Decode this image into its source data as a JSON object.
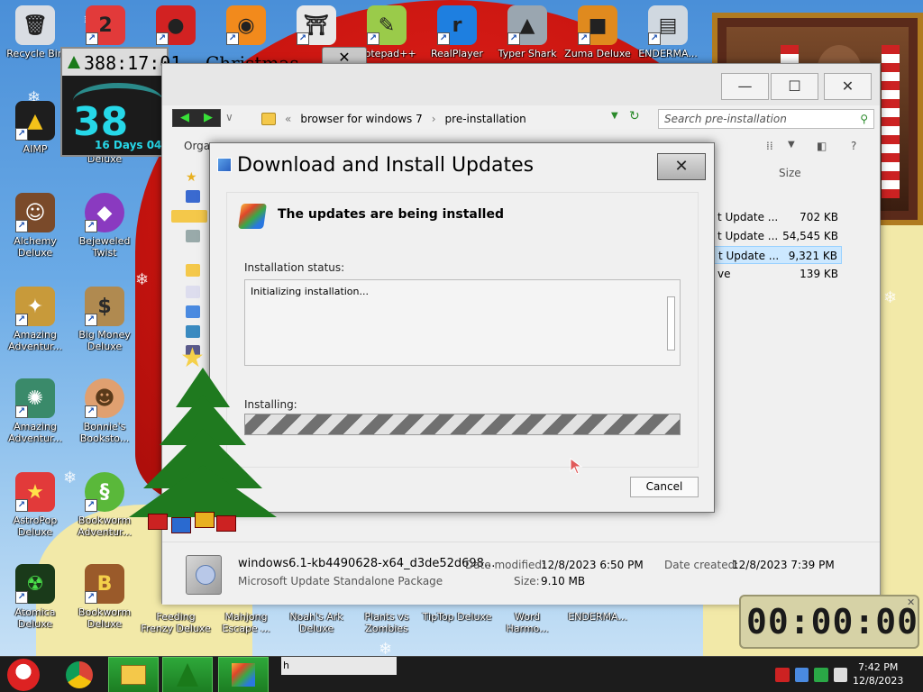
{
  "desktop": {
    "icons_top": [
      {
        "label": "Recycle Bin",
        "name": "recycle-bin",
        "color": "#d9dde3",
        "glyph": "🗑"
      },
      {
        "label": "",
        "name": "number-two-game",
        "color": "#e23a3a",
        "glyph": "2"
      },
      {
        "label": "",
        "name": "red-creature-game",
        "color": "#d22222",
        "glyph": "●"
      },
      {
        "label": "",
        "name": "firefox",
        "color": "#f28a1c",
        "glyph": "◉"
      },
      {
        "label": "",
        "name": "shrine-game",
        "color": "#e8e8e8",
        "glyph": "⛩"
      },
      {
        "label": "Notepad++",
        "name": "notepad-plus-plus",
        "color": "#9acb4a",
        "glyph": "✎"
      },
      {
        "label": "RealPlayer",
        "name": "realplayer",
        "color": "#1e7fe0",
        "glyph": "r"
      },
      {
        "label": "Typer Shark",
        "name": "typer-shark",
        "color": "#9aa6b0",
        "glyph": "▲"
      },
      {
        "label": "Zuma Deluxe",
        "name": "zuma-deluxe",
        "color": "#e08a1e",
        "glyph": "■"
      },
      {
        "label": "ENDERMA...",
        "name": "enderma-top",
        "color": "#d0d8e0",
        "glyph": "▤"
      }
    ],
    "icons_left": [
      {
        "label": "AIMP",
        "name": "aimp"
      },
      {
        "label": "Alchemy Deluxe",
        "name": "alchemy-deluxe"
      },
      {
        "label": "Bejeweled Twist",
        "name": "bejeweled-twist"
      },
      {
        "label": "Amazing Adventur...",
        "name": "amazing-adventures-1"
      },
      {
        "label": "Big Money Deluxe",
        "name": "big-money-deluxe"
      },
      {
        "label": "Amazing Adventur...",
        "name": "amazing-adventures-2"
      },
      {
        "label": "Bonnie's Booksto...",
        "name": "bonnies-bookstore"
      },
      {
        "label": "AstroPop Deluxe",
        "name": "astropop-deluxe"
      },
      {
        "label": "Bookworm Adventur...",
        "name": "bookworm-adventures"
      },
      {
        "label": "Atomica Deluxe",
        "name": "atomica-deluxe"
      },
      {
        "label": "Bookworm Deluxe",
        "name": "bookworm-deluxe"
      }
    ],
    "icons_bottom": [
      {
        "label": "Feeding Frenzy Deluxe",
        "name": "feeding-frenzy"
      },
      {
        "label": "Mahjong Escape ...",
        "name": "mahjong-escape"
      },
      {
        "label": "Noah's Ark Deluxe",
        "name": "noahs-ark"
      },
      {
        "label": "Plants vs Zombies",
        "name": "plants-vs-zombies"
      },
      {
        "label": "TipTop Deluxe",
        "name": "tiptop-deluxe"
      },
      {
        "label": "Word Harmo...",
        "name": "word-harmony"
      },
      {
        "label": "ENDERMA...",
        "name": "enderma-bottom"
      }
    ],
    "deluxe_label": "Deluxe"
  },
  "countdown": {
    "clock": "388:17:01",
    "title": "Christmas",
    "big": "38",
    "days": "16 Days 04"
  },
  "explorer": {
    "breadcrumb": [
      "browser for windows 7",
      "pre-installation"
    ],
    "search_placeholder": "Search pre-installation",
    "organize": "Orga",
    "size_header": "Size",
    "files": [
      {
        "name": "t Update ...",
        "size": "702 KB",
        "selected": false
      },
      {
        "name": "t Update ...",
        "size": "54,545 KB",
        "selected": false
      },
      {
        "name": "t Update ...",
        "size": "9,321 KB",
        "selected": true
      },
      {
        "name": "ve",
        "size": "139 KB",
        "selected": false
      }
    ],
    "details": {
      "filename": "windows6.1-kb4490628-x64_d3de52d698...",
      "type": "Microsoft Update Standalone Package",
      "modified_label": "Date modified:",
      "modified_value": "12/8/2023 6:50 PM",
      "created_label": "Date created:",
      "created_value": "12/8/2023 7:39 PM",
      "size_label": "Size:",
      "size_value": "9.10 MB"
    }
  },
  "dialog": {
    "title": "Download and Install Updates",
    "heading": "The updates are being installed",
    "status_label": "Installation status:",
    "status_text": "Initializing installation...",
    "installing_label": "Installing:",
    "cancel": "Cancel"
  },
  "timer": {
    "value": "00:00:00"
  },
  "taskbar": {
    "input_text": "h",
    "time": "7:42 PM",
    "date": "12/8/2023"
  }
}
